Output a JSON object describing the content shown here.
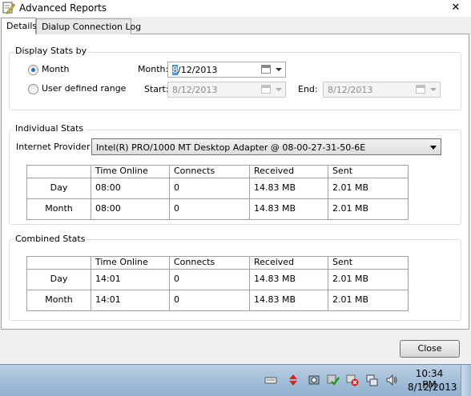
{
  "window": {
    "title": "Advanced Reports",
    "close_glyph": "✕"
  },
  "tabs": [
    {
      "label": "Details",
      "selected": true
    },
    {
      "label": "Dialup Connection Log",
      "selected": false
    }
  ],
  "display_stats": {
    "group_title": "Display Stats by",
    "month_radio_label": "Month",
    "month_radio_checked": true,
    "range_radio_label": "User defined range",
    "range_radio_checked": false,
    "month_label": "Month:",
    "month_value": "8/12/2013",
    "month_value_selected_part": "8",
    "month_value_rest": "/12/2013",
    "start_label": "Start:",
    "start_value": "8/12/2013",
    "end_label": "End:",
    "end_value": "8/12/2013"
  },
  "individual_stats": {
    "group_title": "Individual Stats",
    "provider_label": "Internet Provider",
    "provider_value": "Intel(R) PRO/1000 MT Desktop Adapter @ 08-00-27-31-50-6E",
    "columns": [
      "",
      "Time Online",
      "Connects",
      "Received",
      "Sent"
    ],
    "rows": [
      {
        "label": "Day",
        "time_online": "08:00",
        "connects": "0",
        "received": "14.83 MB",
        "sent": "2.01 MB"
      },
      {
        "label": "Month",
        "time_online": "08:00",
        "connects": "0",
        "received": "14.83 MB",
        "sent": "2.01 MB"
      }
    ]
  },
  "combined_stats": {
    "group_title": "Combined Stats",
    "columns": [
      "",
      "Time Online",
      "Connects",
      "Received",
      "Sent"
    ],
    "rows": [
      {
        "label": "Day",
        "time_online": "14:01",
        "connects": "0",
        "received": "14.83 MB",
        "sent": "2.01 MB"
      },
      {
        "label": "Month",
        "time_online": "14:01",
        "connects": "0",
        "received": "14.83 MB",
        "sent": "2.01 MB"
      }
    ]
  },
  "buttons": {
    "close_label": "Close"
  },
  "taskbar": {
    "time": "10:34 PM",
    "date": "8/12/2013",
    "tray_icons": [
      "keyboard-icon",
      "arrows-icon",
      "virtualbox-icon",
      "security-check-icon",
      "network-error-icon",
      "network-icon",
      "volume-icon"
    ]
  }
}
